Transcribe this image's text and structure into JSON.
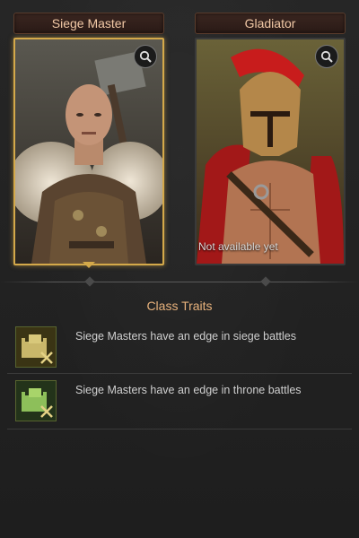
{
  "classes": [
    {
      "name": "Siege Master",
      "selected": true,
      "icon": "magnifier-icon"
    },
    {
      "name": "Gladiator",
      "selected": false,
      "icon": "magnifier-icon",
      "status": "Not available yet"
    }
  ],
  "traits_section": {
    "title": "Class Traits",
    "items": [
      {
        "text": "Siege Masters have an edge in siege battles",
        "icon": "siege-fortress-icon"
      },
      {
        "text": "Siege Masters have an edge in throne battles",
        "icon": "throne-fortress-icon"
      }
    ]
  },
  "colors": {
    "accent_gold": "#d4a94a",
    "title_text": "#f2c9a6",
    "section_title": "#e8b27c"
  }
}
